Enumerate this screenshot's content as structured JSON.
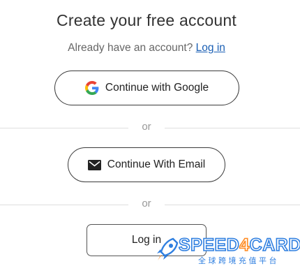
{
  "page": {
    "title": "Create your free account",
    "subtitle": "Already have an account?",
    "login_link": "Log in"
  },
  "buttons": {
    "google": "Continue with Google",
    "email": "Continue With Email",
    "login": "Log in"
  },
  "dividers": [
    "or",
    "or"
  ],
  "watermark": {
    "brand_prefix": "SPEED",
    "brand_digit": "4",
    "brand_suffix": "CARD",
    "tagline": "全球跨境充值平台"
  },
  "icons": {
    "google": "google-g-icon",
    "email": "mail-icon",
    "rocket": "rocket-icon"
  },
  "colors": {
    "link": "#1a5fb4",
    "google_blue": "#4285F4",
    "google_red": "#EA4335",
    "google_yellow": "#FBBC05",
    "google_green": "#34A853",
    "watermark_blue": "#2f7fe0",
    "watermark_orange": "#ff8a1f"
  }
}
